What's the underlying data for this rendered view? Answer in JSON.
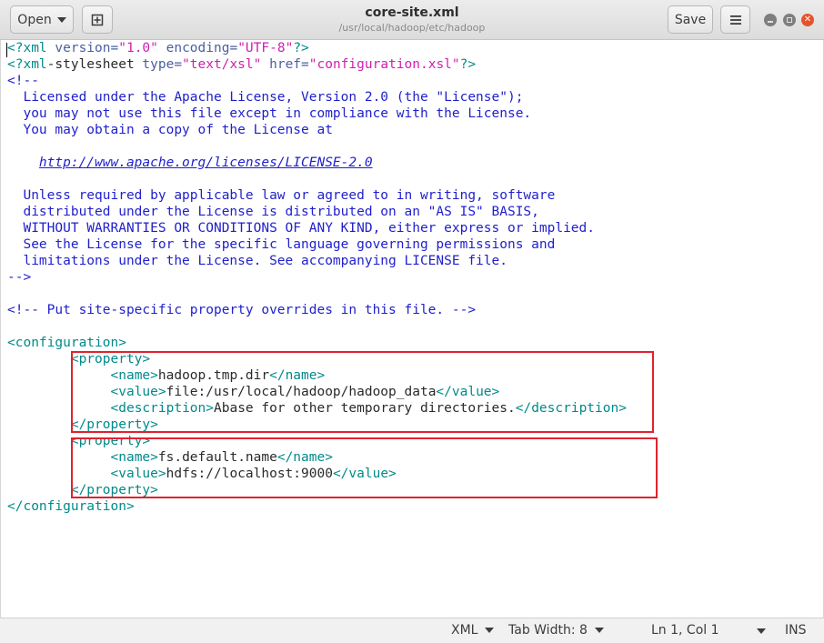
{
  "header": {
    "open_label": "Open",
    "title": "core-site.xml",
    "subtitle": "/usr/local/hadoop/etc/hadoop",
    "save_label": "Save",
    "menu_icon": "hamburger-icon",
    "new_tab_icon": "new-document-icon"
  },
  "editor": {
    "lines": [
      [
        [
          "<",
          "t"
        ],
        [
          "?xml",
          "t"
        ],
        [
          " version=",
          "a"
        ],
        [
          "\"1.0\"",
          "s"
        ],
        [
          " encoding=",
          "a"
        ],
        [
          "\"UTF-8\"",
          "s"
        ],
        [
          "?>",
          "t"
        ]
      ],
      [
        [
          "<?xml",
          "t"
        ],
        [
          "-stylesheet",
          "x"
        ],
        [
          " type=",
          "a"
        ],
        [
          "\"text/xsl\"",
          "s"
        ],
        [
          " href=",
          "a"
        ],
        [
          "\"configuration.xsl\"",
          "s"
        ],
        [
          "?>",
          "t"
        ]
      ],
      [
        [
          "<!--",
          "c"
        ]
      ],
      [
        [
          "  Licensed under the Apache License, Version 2.0 (the \"License\");",
          "c"
        ]
      ],
      [
        [
          "  you may not use this file except in compliance with the License.",
          "c"
        ]
      ],
      [
        [
          "  You may obtain a copy of the License at",
          "c"
        ]
      ],
      [
        [
          "",
          "c"
        ]
      ],
      [
        [
          "    ",
          "c"
        ],
        [
          "http://www.apache.org/licenses/LICENSE-2.0",
          "u"
        ]
      ],
      [
        [
          "",
          "c"
        ]
      ],
      [
        [
          "  Unless required by applicable law or agreed to in writing, software",
          "c"
        ]
      ],
      [
        [
          "  distributed under the License is distributed on an \"AS IS\" BASIS,",
          "c"
        ]
      ],
      [
        [
          "  WITHOUT WARRANTIES OR CONDITIONS OF ANY KIND, either express or implied.",
          "c"
        ]
      ],
      [
        [
          "  See the License for the specific language governing permissions and",
          "c"
        ]
      ],
      [
        [
          "  limitations under the License. See accompanying LICENSE file.",
          "c"
        ]
      ],
      [
        [
          "-->",
          "c"
        ]
      ],
      [
        [
          "",
          "x"
        ]
      ],
      [
        [
          "<!-- Put site-specific property overrides in this file. -->",
          "c"
        ]
      ],
      [
        [
          "",
          "x"
        ]
      ],
      [
        [
          "<configuration>",
          "t"
        ]
      ],
      [
        [
          "        ",
          "x"
        ],
        [
          "<property>",
          "t"
        ]
      ],
      [
        [
          "             ",
          "x"
        ],
        [
          "<name>",
          "t"
        ],
        [
          "hadoop.tmp.dir",
          "x"
        ],
        [
          "</name>",
          "t"
        ]
      ],
      [
        [
          "             ",
          "x"
        ],
        [
          "<value>",
          "t"
        ],
        [
          "file:/usr/local/hadoop/hadoop_data",
          "x"
        ],
        [
          "</value>",
          "t"
        ]
      ],
      [
        [
          "             ",
          "x"
        ],
        [
          "<description>",
          "t"
        ],
        [
          "Abase for other temporary directories.",
          "x"
        ],
        [
          "</description>",
          "t"
        ]
      ],
      [
        [
          "        ",
          "x"
        ],
        [
          "</property>",
          "t"
        ]
      ],
      [
        [
          "        ",
          "x"
        ],
        [
          "<property>",
          "t"
        ]
      ],
      [
        [
          "             ",
          "x"
        ],
        [
          "<name>",
          "t"
        ],
        [
          "fs.default.name",
          "x"
        ],
        [
          "</name>",
          "t"
        ]
      ],
      [
        [
          "             ",
          "x"
        ],
        [
          "<value>",
          "t"
        ],
        [
          "hdfs://localhost:9000",
          "x"
        ],
        [
          "</value>",
          "t"
        ]
      ],
      [
        [
          "        ",
          "x"
        ],
        [
          "</property>",
          "t"
        ]
      ],
      [
        [
          "</configuration>",
          "t"
        ]
      ]
    ]
  },
  "statusbar": {
    "language": "XML",
    "tab_width": "Tab Width: 8",
    "position": "Ln 1, Col 1",
    "mode": "INS"
  }
}
